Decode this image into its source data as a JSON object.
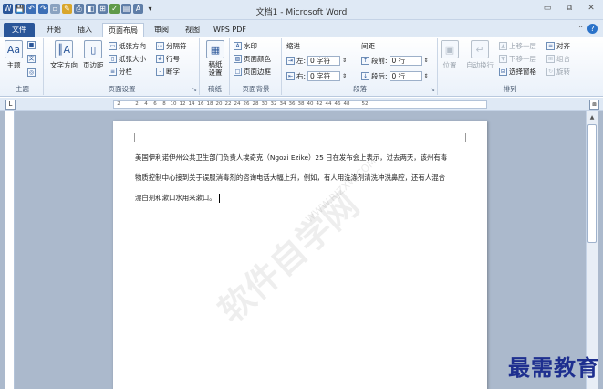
{
  "window": {
    "title": "文档1 - Microsoft Word",
    "controls": [
      "▭",
      "⧉",
      "✕"
    ]
  },
  "qat": [
    "W",
    "💾",
    "↶",
    "↷",
    "▫",
    "✎",
    "⎙",
    "◧",
    "⊞",
    "✓",
    "▤",
    "A",
    "▾"
  ],
  "tabs": [
    "文件",
    "开始",
    "插入",
    "页面布局",
    "审阅",
    "视图",
    "WPS PDF"
  ],
  "active_tab": "页面布局",
  "ribbon": {
    "theme_group": {
      "label": "主题",
      "button": "主题"
    },
    "page_setup_group": {
      "label": "页面设置",
      "text_direction": "文字方向",
      "margins": "页边距",
      "orientation": "纸张方向",
      "size": "纸张大小",
      "columns": "分栏",
      "breaks": "分隔符",
      "line_numbers": "行号",
      "hyphenation": "断字"
    },
    "draft_group": {
      "label": "稿纸",
      "button": "稿纸设置"
    },
    "page_bg_group": {
      "label": "页面背景",
      "watermark": "水印",
      "page_color": "页面颜色",
      "page_borders": "页面边框"
    },
    "paragraph_group": {
      "label": "段落",
      "indent_title": "缩进",
      "spacing_title": "间距",
      "indent_left_label": "左:",
      "indent_left_value": "0 字符",
      "indent_right_label": "右:",
      "indent_right_value": "0 字符",
      "spacing_before_label": "段前:",
      "spacing_before_value": "0 行",
      "spacing_after_label": "段后:",
      "spacing_after_value": "0 行"
    },
    "arrange_group": {
      "label": "排列",
      "position": "位置",
      "wrap_text": "自动换行",
      "bring_forward": "上移一层",
      "send_backward": "下移一层",
      "selection_pane": "选择窗格",
      "align": "对齐",
      "group": "组合",
      "rotate": "旋转"
    }
  },
  "ruler_marks": [
    "2",
    "",
    "2",
    "4",
    "6",
    "8",
    "10",
    "12",
    "14",
    "16",
    "18",
    "20",
    "22",
    "24",
    "26",
    "28",
    "30",
    "32",
    "34",
    "36",
    "38",
    "40",
    "42",
    "44",
    "46",
    "48",
    "",
    "52"
  ],
  "document": {
    "lines": [
      "美国伊利诺伊州公共卫生部门负责人埃奇克（Ngozi Ezike）25 日在发布会上表示，过去两天，该州有毒",
      "物质控制中心接到关于误服消毒剂的咨询电话大幅上升，例如，有人用洗涤剂清洗冲洗鼻腔，还有人混合",
      "漂白剂和漱口水用来漱口。"
    ]
  },
  "watermark": {
    "main": "软件自学网",
    "sub": "WWW.RJZXW.COM"
  },
  "brand": "最需教育"
}
